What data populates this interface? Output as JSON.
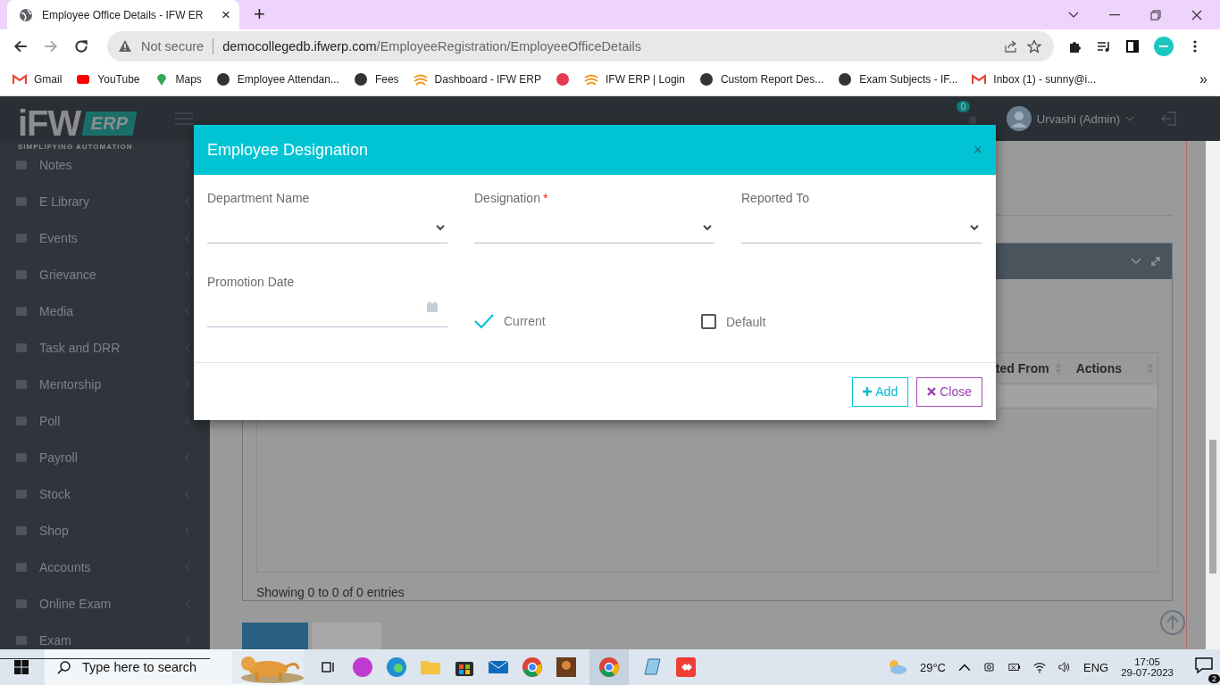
{
  "browser": {
    "tab": {
      "title": "Employee Office Details - IFW ER",
      "close": "×"
    },
    "new_tab": "+",
    "address": {
      "security": "Not secure",
      "host": "democollegedb.ifwerp.com",
      "path": "/EmployeeRegistration/EmployeeOfficeDetails"
    },
    "bookmarks": [
      {
        "label": "Gmail",
        "kind": "gmail"
      },
      {
        "label": "YouTube",
        "kind": "youtube"
      },
      {
        "label": "Maps",
        "kind": "maps"
      },
      {
        "label": "Employee Attendan...",
        "kind": "globe"
      },
      {
        "label": "Fees",
        "kind": "globe"
      },
      {
        "label": "Dashboard - IFW ERP",
        "kind": "ifw"
      },
      {
        "kind": "red"
      },
      {
        "label": "IFW ERP | Login",
        "kind": "ifw"
      },
      {
        "label": "Custom Report Des...",
        "kind": "globe"
      },
      {
        "label": "Exam Subjects - IF...",
        "kind": "globe"
      },
      {
        "label": "Inbox (1) - sunny@i...",
        "kind": "gmail"
      }
    ],
    "more": "»"
  },
  "logo": {
    "name": "iFW",
    "badge": "ERP",
    "tagline": "SIMPLIFYING AUTOMATION"
  },
  "header": {
    "notifications": "0",
    "user": "Urvashi (Admin)"
  },
  "sidebar": {
    "items": [
      {
        "label": "Notes"
      },
      {
        "label": "E Library"
      },
      {
        "label": "Events"
      },
      {
        "label": "Grievance"
      },
      {
        "label": "Media"
      },
      {
        "label": "Task and DRR"
      },
      {
        "label": "Mentorship"
      },
      {
        "label": "Poll"
      },
      {
        "label": "Payroll"
      },
      {
        "label": "Stock"
      },
      {
        "label": "Shop"
      },
      {
        "label": "Accounts"
      },
      {
        "label": "Online Exam"
      },
      {
        "label": "Exam"
      }
    ]
  },
  "page": {
    "table": {
      "columns": [
        "ted From",
        "Actions"
      ]
    },
    "info": "Showing 0 to 0 of 0 entries"
  },
  "modal": {
    "title": "Employee Designation",
    "close": "×",
    "fields": [
      {
        "label": "Department Name",
        "kind": "select"
      },
      {
        "label": "Designation",
        "kind": "select",
        "marker": "*"
      },
      {
        "label": "Reported To",
        "kind": "select"
      },
      {
        "label": "Promotion Date",
        "kind": "date"
      }
    ],
    "options": [
      {
        "label": "Current",
        "checked": true
      },
      {
        "label": "Default",
        "checked": false
      }
    ],
    "buttons": [
      {
        "label": "Add",
        "kind": "add"
      },
      {
        "label": "Close",
        "kind": "close"
      }
    ]
  },
  "taskbar": {
    "search_placeholder": "Type here to search",
    "temperature": "29°C",
    "language": "ENG",
    "time": "17:05",
    "date": "29-07-2023",
    "notifications": "2"
  }
}
